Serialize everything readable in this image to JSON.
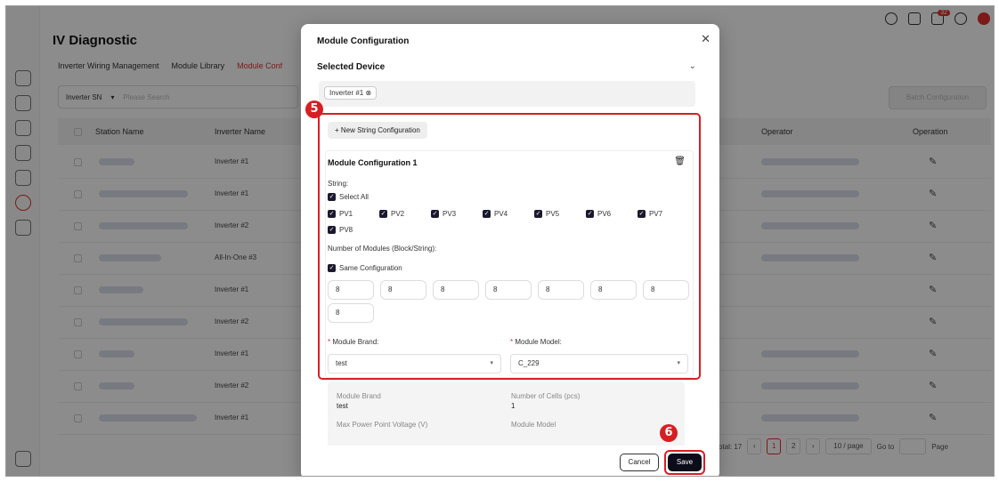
{
  "app": {
    "title": "IV Diagnostic",
    "tabs": [
      "Inverter Wiring Management",
      "Module Library",
      "Module Conf"
    ],
    "active_tab_index": 2,
    "notification_count": "32"
  },
  "filter": {
    "field": "Inverter SN",
    "placeholder": "Please Search"
  },
  "batch_button": "Batch Configuration",
  "table": {
    "headers": [
      "Station Name",
      "Inverter Name",
      "Operator",
      "Operation"
    ],
    "rows": [
      {
        "inverter": "Inverter #1"
      },
      {
        "inverter": "Inverter #1"
      },
      {
        "inverter": "Inverter #2"
      },
      {
        "inverter": "All-In-One #3"
      },
      {
        "inverter": "Inverter #1"
      },
      {
        "inverter": "Inverter #2"
      },
      {
        "inverter": "Inverter #1"
      },
      {
        "inverter": "Inverter #2"
      },
      {
        "inverter": "Inverter #1"
      }
    ]
  },
  "pagination": {
    "total": "otal: 17",
    "pages": [
      "1",
      "2"
    ],
    "current": "1",
    "page_size": "10 / page",
    "goto": "Go to",
    "page": "Page"
  },
  "modal": {
    "title": "Module Configuration",
    "selected_device": "Selected Device",
    "device_tag": "Inverter #1",
    "new_string_button": "New String Configuration",
    "config_title": "Module Configuration 1",
    "string_label": "String:",
    "select_all": "Select All",
    "strings": [
      "PV1",
      "PV2",
      "PV3",
      "PV4",
      "PV5",
      "PV6",
      "PV7",
      "PV8"
    ],
    "num_modules_label": "Number of Modules (Block/String):",
    "same_config": "Same Configuration",
    "module_counts": [
      "8",
      "8",
      "8",
      "8",
      "8",
      "8",
      "8",
      "8"
    ],
    "brand_label": "Module Brand:",
    "brand_value": "test",
    "model_label": "Module Model:",
    "model_value": "C_229",
    "info": {
      "brand_key": "Module Brand",
      "brand_val": "test",
      "cells_key": "Number of Cells (pcs)",
      "cells_val": "1",
      "vmp_key": "Max Power Point Voltage (V)",
      "model_key": "Module Model"
    },
    "cancel": "Cancel",
    "save": "Save"
  },
  "steps": {
    "five": "5",
    "six": "6"
  }
}
